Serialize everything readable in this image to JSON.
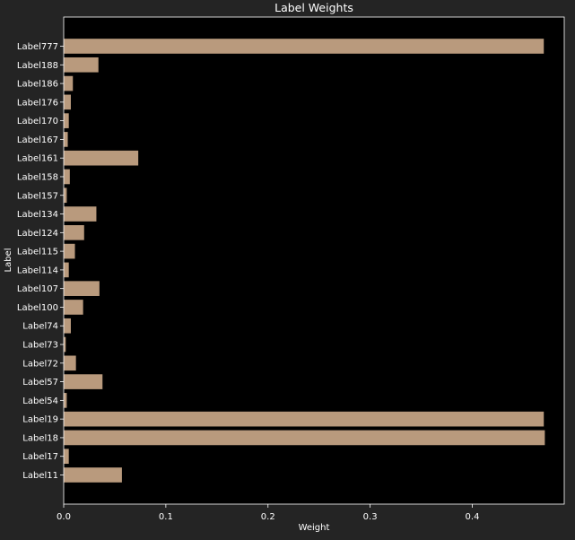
{
  "chart_data": {
    "type": "bar",
    "orientation": "horizontal",
    "title": "Label Weights",
    "xlabel": "Weight",
    "ylabel": "Label",
    "categories": [
      "Label777",
      "Label188",
      "Label186",
      "Label176",
      "Label170",
      "Label167",
      "Label161",
      "Label158",
      "Label157",
      "Label134",
      "Label124",
      "Label115",
      "Label114",
      "Label107",
      "Label100",
      "Label74",
      "Label73",
      "Label72",
      "Label57",
      "Label54",
      "Label19",
      "Label18",
      "Label17",
      "Label11"
    ],
    "values": [
      0.47,
      0.034,
      0.009,
      0.007,
      0.005,
      0.004,
      0.073,
      0.006,
      0.003,
      0.032,
      0.02,
      0.011,
      0.005,
      0.035,
      0.019,
      0.007,
      0.002,
      0.012,
      0.038,
      0.003,
      0.47,
      0.471,
      0.005,
      0.057
    ],
    "xlim": [
      0,
      0.49
    ],
    "xticks": [
      0,
      0.1,
      0.2,
      0.3,
      0.4
    ],
    "xtick_labels": [
      "0.0",
      "0.1",
      "0.2",
      "0.3",
      "0.4"
    ],
    "grid": false,
    "colors": {
      "figure_background": "#242424",
      "plot_background": "#000000",
      "bar": "#b99a7d",
      "text": "#ffffff",
      "axes_edge": "#ffffff"
    }
  }
}
